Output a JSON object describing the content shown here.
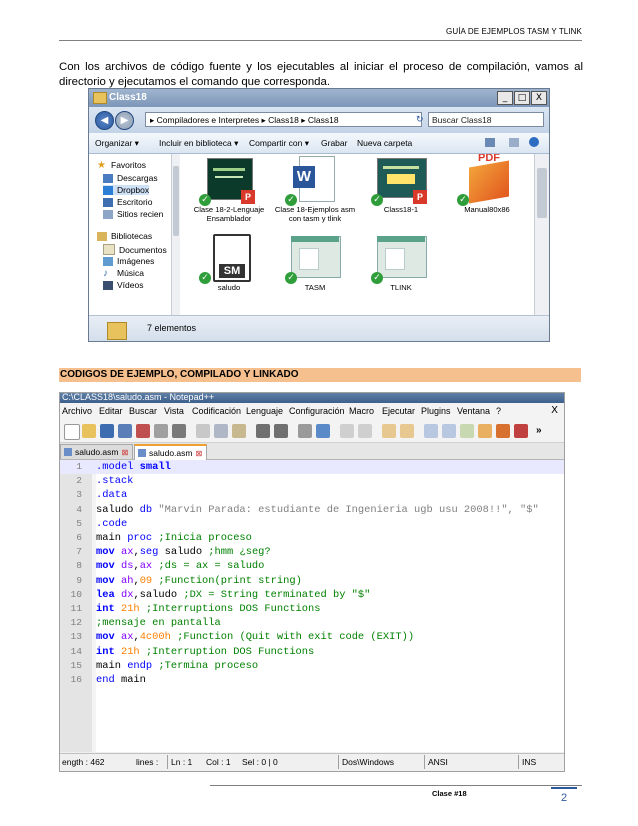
{
  "header": {
    "title": "GUÍA DE EJEMPLOS TASM Y TLINK"
  },
  "intro": "Con los archivos de código fuente y los ejecutables al iniciar el proceso de compilación, vamos al directorio y ejecutamos el comando que corresponda.",
  "explorer": {
    "title": "Class18",
    "window_buttons": [
      "_",
      "□",
      "X"
    ],
    "address": "▸ Compiladores e Interpretes ▸ Class18 ▸ Class18",
    "search_placeholder": "Buscar Class18",
    "commands": [
      "Organizar ▾",
      "Incluir en biblioteca ▾",
      "Compartir con ▾",
      "Grabar",
      "Nueva carpeta"
    ],
    "nav": {
      "favorites": "Favoritos",
      "fav_items": [
        "Descargas",
        "Dropbox",
        "Escritorio",
        "Sitios recien"
      ],
      "libraries": "Bibliotecas",
      "lib_items": [
        "Documentos",
        "Imágenes",
        "Música",
        "Vídeos"
      ]
    },
    "files": [
      {
        "name": "Clase 18-2-Lenguaje Ensamblador",
        "icon": "pdf-thumbnail-icon"
      },
      {
        "name": "Clase 18-Ejemplos asm con tasm y tlink",
        "icon": "word-document-icon"
      },
      {
        "name": "Class18-1",
        "icon": "pdf-thumbnail-icon"
      },
      {
        "name": "Manual80x86",
        "icon": "pdf-icon"
      },
      {
        "name": "saludo",
        "icon": "asm-file-icon",
        "badge": "SM"
      },
      {
        "name": "TASM",
        "icon": "executable-icon"
      },
      {
        "name": "TLINK",
        "icon": "executable-icon"
      }
    ],
    "status": "7 elementos"
  },
  "section_heading": "CODIGOS DE EJEMPLO, COMPILADO Y LINKADO",
  "notepad": {
    "title": "C:\\CLASS18\\saludo.asm - Notepad++",
    "menu": [
      "Archivo",
      "Editar",
      "Buscar",
      "Vista",
      "Codificación",
      "Lenguaje",
      "Configuración",
      "Macro",
      "Ejecutar",
      "Plugins",
      "Ventana",
      "?"
    ],
    "close_glyph": "X",
    "overflow_glyph": "»",
    "tabs": [
      "saludo.asm",
      "saludo.asm"
    ],
    "lines": [
      [
        {
          "t": ".model ",
          "c": "kw2"
        },
        {
          "t": "small",
          "c": "kw"
        }
      ],
      [
        {
          "t": ".stack",
          "c": "kw2"
        }
      ],
      [
        {
          "t": ".data",
          "c": "kw2"
        }
      ],
      [
        {
          "t": "saludo ",
          "c": "plain"
        },
        {
          "t": "db ",
          "c": "kw2"
        },
        {
          "t": "\"Marvin Parada: estudiante de Ingenieria ugb usu 2008!!\", \"$\"",
          "c": "str"
        }
      ],
      [
        {
          "t": ".code",
          "c": "kw2"
        }
      ],
      [
        {
          "t": "main ",
          "c": "plain"
        },
        {
          "t": "proc ",
          "c": "kw2"
        },
        {
          "t": ";Inicia proceso",
          "c": "cmt"
        }
      ],
      [
        {
          "t": "mov ",
          "c": "kw"
        },
        {
          "t": "ax",
          "c": "reg"
        },
        {
          "t": ",",
          "c": "plain"
        },
        {
          "t": "seg ",
          "c": "kw2"
        },
        {
          "t": "saludo ",
          "c": "plain"
        },
        {
          "t": ";hmm ¿seg?",
          "c": "cmt"
        }
      ],
      [
        {
          "t": "mov ",
          "c": "kw"
        },
        {
          "t": "ds",
          "c": "reg"
        },
        {
          "t": ",",
          "c": "plain"
        },
        {
          "t": "ax ",
          "c": "reg"
        },
        {
          "t": ";ds = ax = saludo",
          "c": "cmt"
        }
      ],
      [
        {
          "t": "mov ",
          "c": "kw"
        },
        {
          "t": "ah",
          "c": "reg"
        },
        {
          "t": ",",
          "c": "plain"
        },
        {
          "t": "09 ",
          "c": "num"
        },
        {
          "t": ";Function(print string)",
          "c": "cmt"
        }
      ],
      [
        {
          "t": "lea ",
          "c": "kw"
        },
        {
          "t": "dx",
          "c": "reg"
        },
        {
          "t": ",saludo ",
          "c": "plain"
        },
        {
          "t": ";DX = String terminated by \"$\"",
          "c": "cmt"
        }
      ],
      [
        {
          "t": "int ",
          "c": "kw"
        },
        {
          "t": "21h ",
          "c": "num"
        },
        {
          "t": ";Interruptions DOS Functions",
          "c": "cmt"
        }
      ],
      [
        {
          "t": ";mensaje en pantalla",
          "c": "cmt"
        }
      ],
      [
        {
          "t": "mov ",
          "c": "kw"
        },
        {
          "t": "ax",
          "c": "reg"
        },
        {
          "t": ",",
          "c": "plain"
        },
        {
          "t": "4c00h ",
          "c": "num"
        },
        {
          "t": ";Function (Quit with exit code (EXIT))",
          "c": "cmt"
        }
      ],
      [
        {
          "t": "int ",
          "c": "kw"
        },
        {
          "t": "21h ",
          "c": "num"
        },
        {
          "t": ";Interruption DOS Functions",
          "c": "cmt"
        }
      ],
      [
        {
          "t": "main ",
          "c": "plain"
        },
        {
          "t": "endp ",
          "c": "kw2"
        },
        {
          "t": ";Termina proceso",
          "c": "cmt"
        }
      ],
      [
        {
          "t": "end ",
          "c": "kw2"
        },
        {
          "t": "main",
          "c": "plain"
        }
      ]
    ],
    "status": {
      "length": "ength : 462",
      "lines": "lines : ",
      "ln": "Ln : 1",
      "col": "Col : 1",
      "sel": "Sel : 0 | 0",
      "eol": "Dos\\Windows",
      "enc": "ANSI",
      "mode": "INS"
    }
  },
  "footer": {
    "label": "Clase #18",
    "page": "2"
  }
}
